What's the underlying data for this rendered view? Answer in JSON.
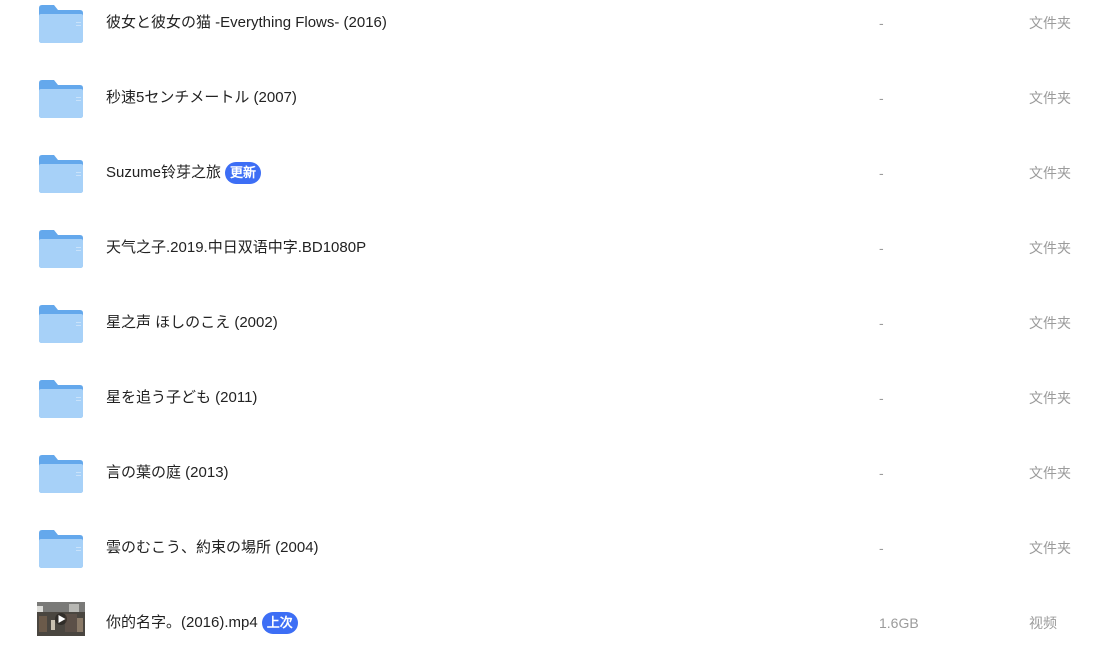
{
  "files": [
    {
      "name": "彼女と彼女の猫 -Everything Flows- (2016)",
      "badge": "",
      "size": "-",
      "type": "文件夹",
      "icon": "folder-icon"
    },
    {
      "name": "秒速5センチメートル (2007)",
      "badge": "",
      "size": "-",
      "type": "文件夹",
      "icon": "folder-icon"
    },
    {
      "name": "Suzume铃芽之旅",
      "badge": "更新",
      "size": "-",
      "type": "文件夹",
      "icon": "folder-icon"
    },
    {
      "name": "天气之子.2019.中日双语中字.BD1080P",
      "badge": "",
      "size": "-",
      "type": "文件夹",
      "icon": "folder-icon"
    },
    {
      "name": "星之声 ほしのこえ (2002)",
      "badge": "",
      "size": "-",
      "type": "文件夹",
      "icon": "folder-icon"
    },
    {
      "name": "星を追う子ども (2011)",
      "badge": "",
      "size": "-",
      "type": "文件夹",
      "icon": "folder-icon"
    },
    {
      "name": "言の葉の庭 (2013)",
      "badge": "",
      "size": "-",
      "type": "文件夹",
      "icon": "folder-icon"
    },
    {
      "name": "雲のむこう、約束の場所 (2004)",
      "badge": "",
      "size": "-",
      "type": "文件夹",
      "icon": "folder-icon"
    },
    {
      "name": "你的名字。(2016).mp4",
      "badge": "上次",
      "size": "1.6GB",
      "type": "视频",
      "icon": "video-thumbnail-icon"
    }
  ],
  "colors": {
    "folder_back": "#64a8ec",
    "folder_front": "#a7d1f8",
    "badge_bg": "#3d6ef5",
    "muted_text": "#9b9b9b"
  }
}
